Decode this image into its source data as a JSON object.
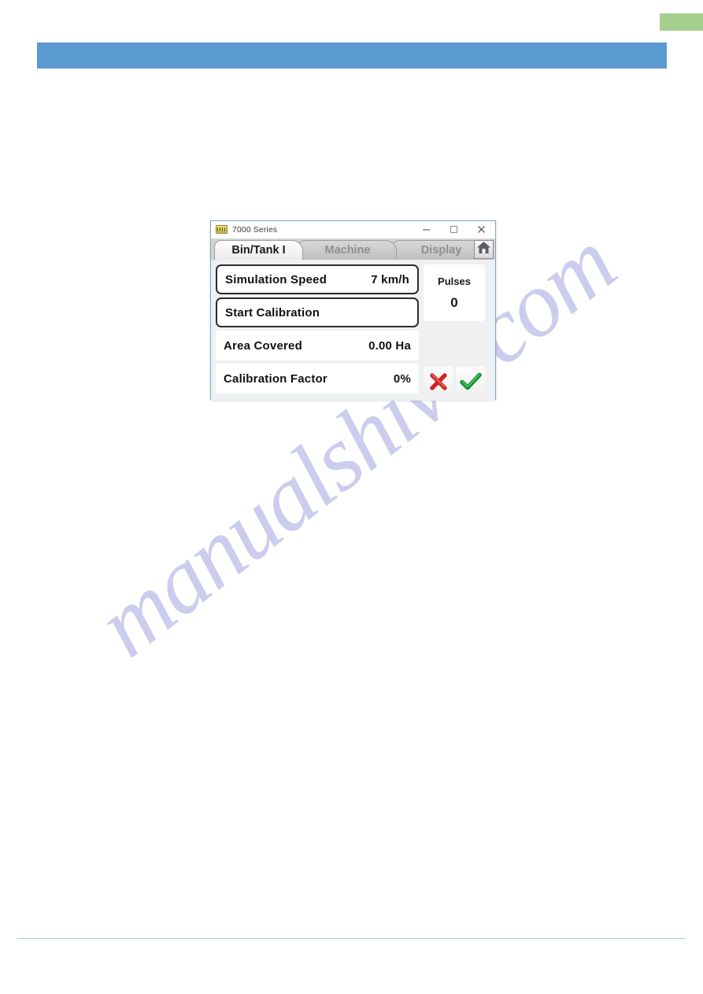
{
  "page": {
    "green_marker": "",
    "header_band": "",
    "watermark": "manualshive.com",
    "accent_blue": "#5b9bd1",
    "accent_green": "#a6cf8e",
    "watermark_color": "#ccccee",
    "footer_rule_color": "#a8cbe2"
  },
  "dialog": {
    "titlebar": {
      "icon": "device-icon",
      "title": "7000 Series",
      "minimize_label": "─",
      "maximize_label": "□",
      "close_label": "✕"
    },
    "tabs": [
      {
        "label": "Bin/Tank  I",
        "active": true
      },
      {
        "label": "Machine",
        "active": false
      },
      {
        "label": "Display",
        "active": false
      }
    ],
    "home_button": "home-icon",
    "rows": [
      {
        "label": "Simulation Speed",
        "value": "7  km/h",
        "bordered": true
      },
      {
        "label": "Start  Calibration",
        "value": "",
        "bordered": true
      },
      {
        "label": "Area  Covered",
        "value": "0.00  Ha",
        "bordered": false
      },
      {
        "label": "Calibration  Factor",
        "value": "0%",
        "bordered": false
      }
    ],
    "pulses": {
      "title": "Pulses",
      "value": "0"
    },
    "actions": {
      "cancel": "cancel-cross-icon",
      "confirm": "confirm-check-icon"
    }
  }
}
